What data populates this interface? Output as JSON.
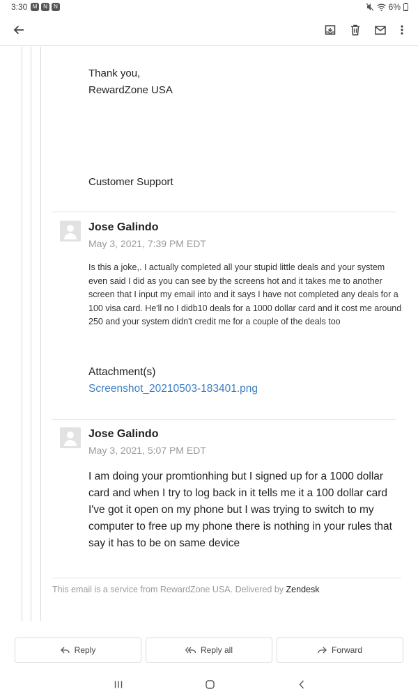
{
  "status_bar": {
    "time": "3:30",
    "notif_icons": [
      "mail-notification-icon",
      "app-notification-icon",
      "app-notification-icon"
    ],
    "battery": "6%"
  },
  "toolbar": {
    "back_icon": "arrow-back-icon",
    "actions": [
      "archive-icon",
      "delete-icon",
      "mark-unread-icon",
      "more-vert-icon"
    ]
  },
  "signature": {
    "thanks": "Thank you,",
    "company": "RewardZone USA",
    "team": "Customer Support"
  },
  "messages": [
    {
      "sender": "Jose Galindo",
      "date": "May 3, 2021, 7:39 PM EDT",
      "body": "Is this a joke,. I actually completed all your stupid little deals and your system even said I did as you can see by the screens hot and it takes me to another screen that I input my email into and it says I have not completed any deals for a 100 visa card. He'll no I didb10 deals for a 1000 dollar card  and it cost me around 250 and your system didn't credit me for a couple of the deals too",
      "attachment_label": "Attachment(s)",
      "attachment_name": "Screenshot_20210503-183401.png"
    },
    {
      "sender": "Jose Galindo",
      "date": "May 3, 2021, 5:07 PM EDT",
      "body": "I am doing your promtionhing but I signed up for a 1000 dollar card and when I try to log back in it tells me it a 100 dollar card I've got it open on my phone but I was trying to switch to my computer to free up my phone there is nothing in your rules that say it has to be on same device"
    }
  ],
  "footer": {
    "note": "This email is a service from RewardZone USA. Delivered by",
    "provider": "Zendesk"
  },
  "actions": {
    "reply": "Reply",
    "reply_all": "Reply all",
    "forward": "Forward"
  },
  "nav": {
    "icons": [
      "recent-apps-icon",
      "home-icon",
      "back-nav-icon"
    ]
  }
}
